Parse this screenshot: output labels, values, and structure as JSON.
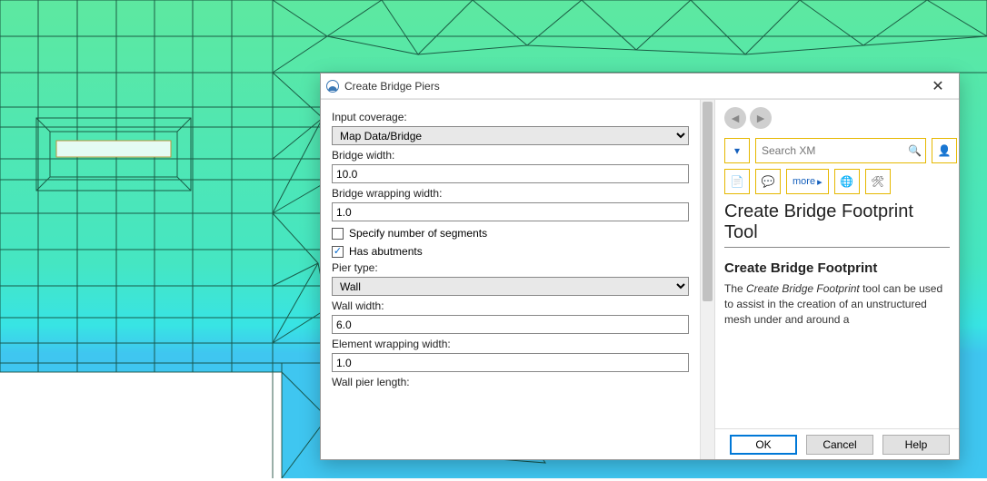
{
  "dialog": {
    "title": "Create Bridge Piers",
    "form": {
      "input_coverage_label": "Input coverage:",
      "input_coverage_value": "Map Data/Bridge",
      "bridge_width_label": "Bridge width:",
      "bridge_width_value": "10.0",
      "bridge_wrapping_width_label": "Bridge wrapping width:",
      "bridge_wrapping_width_value": "1.0",
      "specify_segments_label": "Specify number of segments",
      "specify_segments_checked": false,
      "has_abutments_label": "Has abutments",
      "has_abutments_checked": true,
      "pier_type_label": "Pier type:",
      "pier_type_value": "Wall",
      "wall_width_label": "Wall width:",
      "wall_width_value": "6.0",
      "element_wrapping_width_label": "Element wrapping width:",
      "element_wrapping_width_value": "1.0",
      "wall_pier_length_label": "Wall pier length:"
    },
    "help": {
      "search_placeholder": "Search XM",
      "more_label": "more",
      "title": "Create Bridge Footprint Tool",
      "heading": "Create Bridge Footprint",
      "body_prefix": "The ",
      "body_em": "Create Bridge Footprint",
      "body_suffix": " tool can be used to assist in the creation of an unstructured mesh under and around a"
    },
    "buttons": {
      "ok": "OK",
      "cancel": "Cancel",
      "help": "Help"
    }
  },
  "colors": {
    "mesh_green": "#5de8a0",
    "mesh_teal": "#45e6c2",
    "mesh_blue": "#3fc6f0",
    "accent_yellow": "#e6b800",
    "primary_blue": "#0078d7"
  }
}
